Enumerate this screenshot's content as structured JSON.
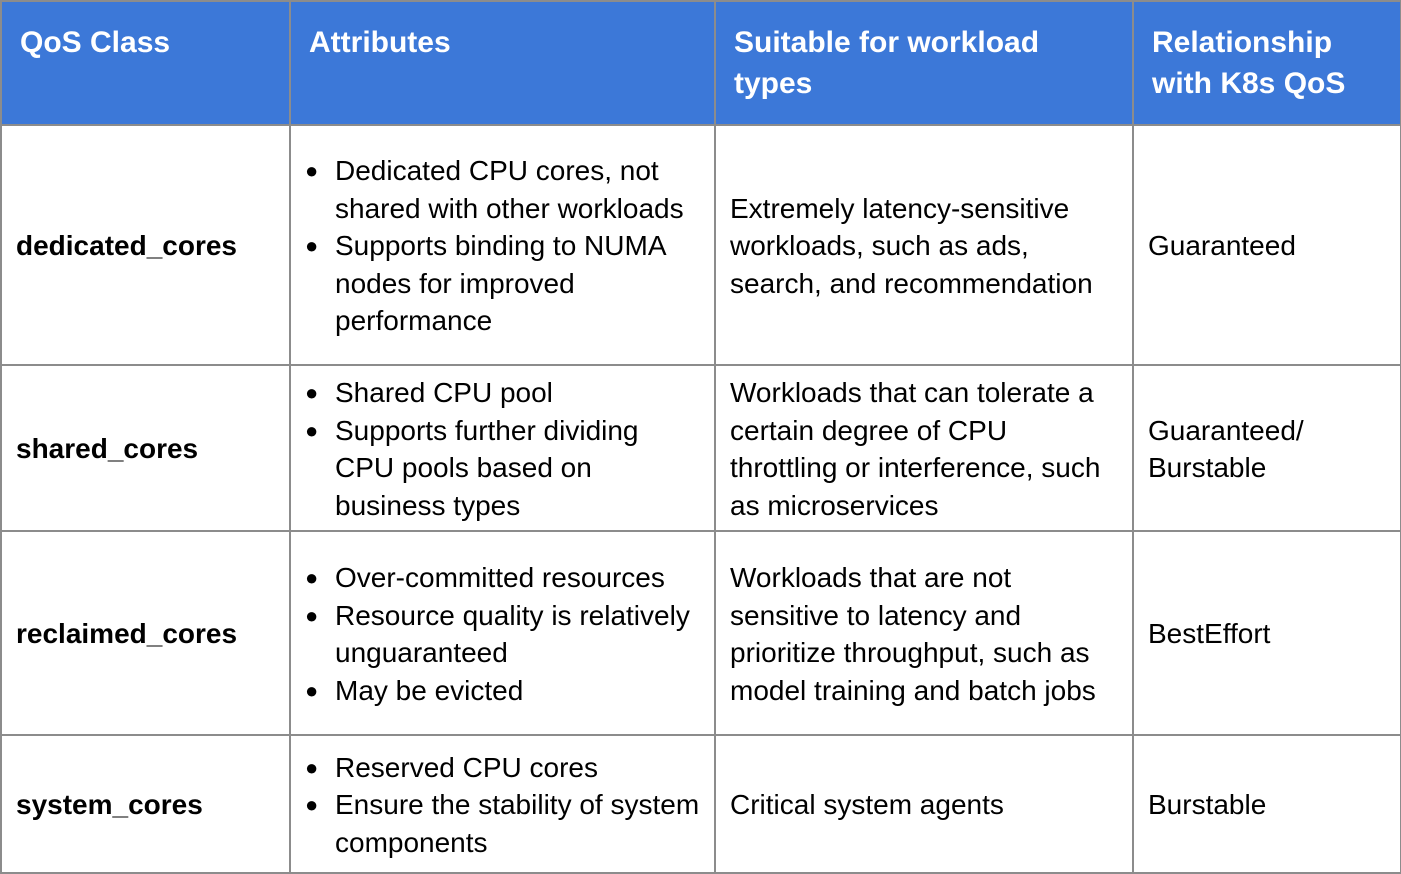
{
  "table": {
    "headers": [
      "QoS Class",
      "Attributes",
      "Suitable for workload types",
      "Relationship with K8s QoS"
    ],
    "colors": {
      "header_bg": "#3c78d8",
      "header_text": "#ffffff",
      "border": "#8c8c8c"
    },
    "bullet_icon": "●",
    "rows": [
      {
        "qos_class": "dedicated_cores",
        "attributes": [
          "Dedicated CPU cores, not shared with other workloads",
          "Supports binding to NUMA nodes for improved performance"
        ],
        "workload_types": "Extremely latency-sensitive workloads, such as ads, search, and recommendation",
        "k8s_qos": "Guaranteed"
      },
      {
        "qos_class": "shared_cores",
        "attributes": [
          "Shared CPU pool",
          "Supports further dividing CPU pools based on business types"
        ],
        "workload_types": "Workloads that can tolerate a certain degree of CPU throttling or interference, such as microservices",
        "k8s_qos": "Guaranteed/ Burstable"
      },
      {
        "qos_class": "reclaimed_cores",
        "attributes": [
          "Over-committed resources",
          "Resource quality is relatively unguaranteed",
          "May be evicted"
        ],
        "workload_types": "Workloads that are not sensitive to latency and prioritize throughput, such as model training and batch jobs",
        "k8s_qos": "BestEffort"
      },
      {
        "qos_class": "system_cores",
        "attributes": [
          "Reserved CPU cores",
          "Ensure the stability of system components"
        ],
        "workload_types": "Critical system agents",
        "k8s_qos": "Burstable"
      }
    ]
  }
}
